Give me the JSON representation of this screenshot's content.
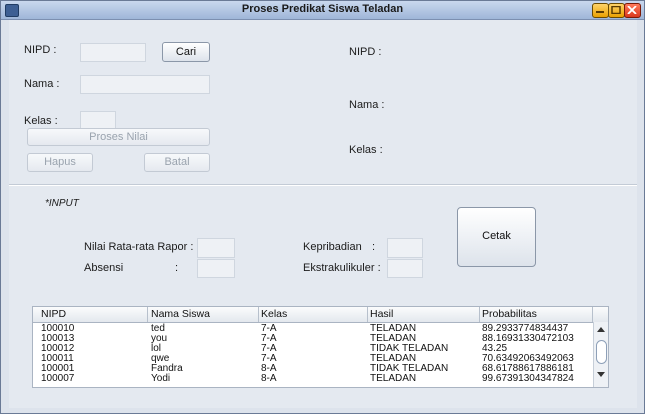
{
  "window": {
    "title": "Proses Predikat Siswa Teladan"
  },
  "form_left": {
    "nipd_label": "NIPD  :",
    "nipd_value": "",
    "cari_button": "Cari",
    "nama_label": "Nama :",
    "nama_value": "",
    "kelas_label": "Kelas  :",
    "kelas_value": "",
    "proses_button": "Proses Nilai",
    "hapus_button": "Hapus",
    "batal_button": "Batal"
  },
  "form_right": {
    "nipd_label": "NIPD  :",
    "nama_label": "Nama :",
    "kelas_label": "Kelas  :"
  },
  "input_section": {
    "title": "*INPUT",
    "rapor_label": "Nilai Rata-rata Rapor  :",
    "absensi_label": "Absensi",
    "absensi_colon": ":",
    "kepribadian_label": "Kepribadian",
    "kepribadian_colon": ":",
    "ekstra_label": "Ekstrakulikuler :",
    "cetak_button": "Cetak"
  },
  "table": {
    "columns": [
      "NIPD",
      "Nama Siswa",
      "Kelas",
      "Hasil",
      "Probabilitas"
    ],
    "rows": [
      [
        "100010",
        "ted",
        "7-A",
        "TELADAN",
        "89.2933774834437"
      ],
      [
        "100013",
        "you",
        "7-A",
        "TELADAN",
        "88.16931330472103"
      ],
      [
        "100012",
        "lol",
        "7-A",
        "TIDAK TELADAN",
        "43.25"
      ],
      [
        "100011",
        "qwe",
        "7-A",
        "TELADAN",
        "70.63492063492063"
      ],
      [
        "100001",
        "Fandra",
        "8-A",
        "TIDAK TELADAN",
        "68.61788617886181"
      ],
      [
        "100007",
        "Yodi",
        "8-A",
        "TELADAN",
        "99.67391304347824"
      ]
    ]
  }
}
